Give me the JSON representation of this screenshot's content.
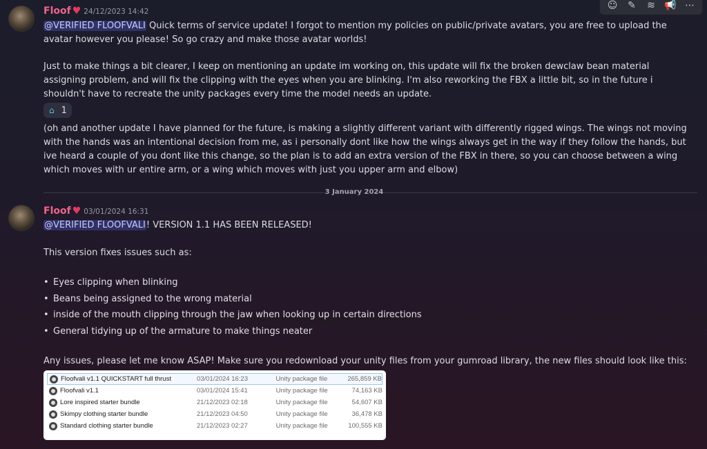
{
  "toolbar": {
    "icons": [
      "emoji-icon",
      "edit-icon",
      "forward-icon",
      "megaphone-icon",
      "more-icon"
    ]
  },
  "messages": [
    {
      "username": "Floof",
      "timestamp": "24/12/2023 14:42",
      "mention": "@VERIFIED FLOOFVALI",
      "paragraph1_rest": " Quick terms of service update! I forgot to mention my policies on public/private avatars, you are free to upload the avatar however you please! So go crazy and make those avatar worlds!",
      "paragraph2": "Just to make things a bit clearer, I keep on mentioning an update im working on, this update will fix the broken dewclaw bean material assigning problem, and will fix the clipping with the eyes when you are blinking. I'm also reworking the FBX a little bit, so in the future i shouldn't have to recreate the unity packages every time the model needs an update.",
      "reaction_count": "1",
      "paragraph3": "(oh and another update I have planned for the future, is making a slightly different variant with differently rigged wings. The wings not moving with the hands was an intentional decision from me, as i personally dont like how the wings always get in the way if they follow the hands, but ive heard a couple of you dont like this change, so the plan is to add an extra version of the FBX in there, so you can choose between a wing which moves with ur entire arm, or a wing which moves with just you upper arm and elbow)"
    },
    {
      "username": "Floof",
      "timestamp": "03/01/2024 16:31",
      "mention": "@VERIFIED FLOOFVALI",
      "line1_rest": "! VERSION 1.1 HAS BEEN RELEASED!",
      "intro": "This version fixes issues such as:",
      "bullets": [
        "Eyes clipping when blinking",
        "Beans being assigned to the wrong material",
        "inside of the mouth clipping through the jaw when looking up in certain directions",
        "General tidying up of the armature to make things neater"
      ],
      "outro": "Any issues, please let me know ASAP! Make sure you redownload your unity files from your gumroad library, the new files should look like this:",
      "files": [
        {
          "name": "Floofvali v1.1 QUICKSTART full thrust",
          "date": "03/01/2024 16:23",
          "type": "Unity package file",
          "size": "265,859 KB"
        },
        {
          "name": "Floofvali v1.1",
          "date": "03/01/2024 15:41",
          "type": "Unity package file",
          "size": "74,163 KB"
        },
        {
          "name": "Lore inspired starter bundle",
          "date": "21/12/2023 02:18",
          "type": "Unity package file",
          "size": "54,607 KB"
        },
        {
          "name": "Skimpy clothing starter bundle",
          "date": "21/12/2023 04:50",
          "type": "Unity package file",
          "size": "36,478 KB"
        },
        {
          "name": "Standard clothing starter bundle",
          "date": "21/12/2023 02:27",
          "type": "Unity package file",
          "size": "100,555 KB"
        }
      ]
    }
  ],
  "divider": "3 January 2024",
  "colors": {
    "username": "#f0658c",
    "mention_bg": "#3d4280",
    "heart": "#e8395d"
  }
}
